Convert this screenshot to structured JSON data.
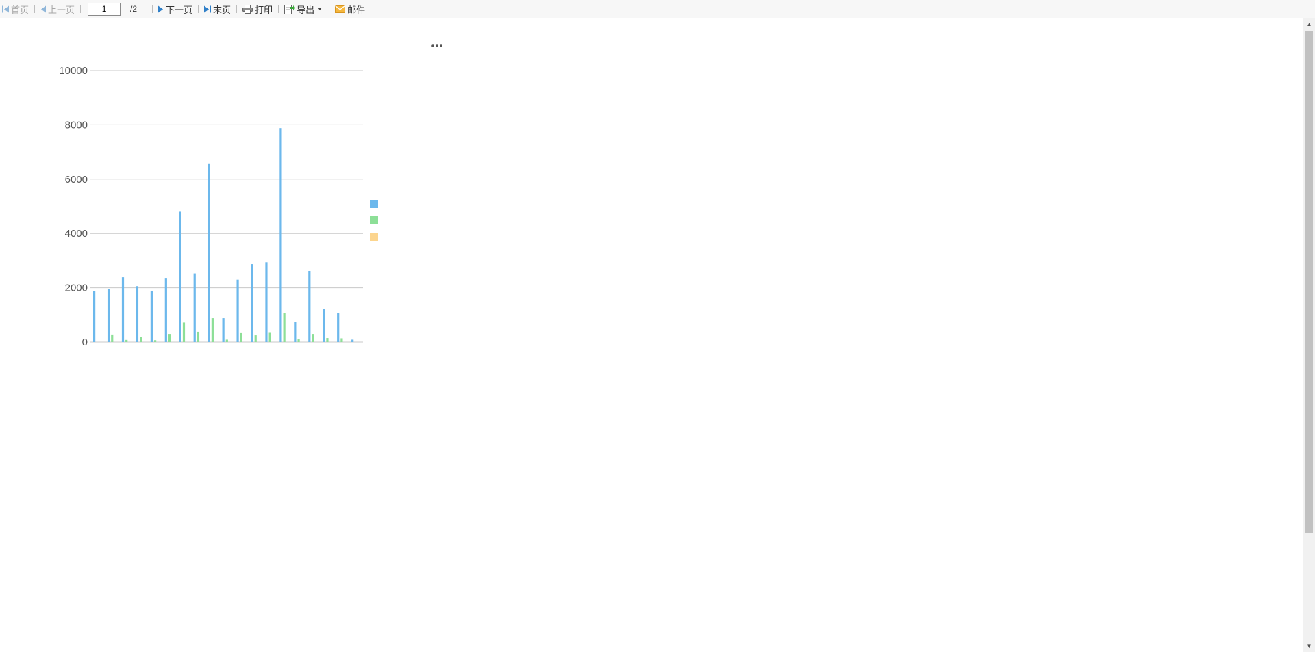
{
  "toolbar": {
    "first": "首页",
    "prev": "上一页",
    "page_value": "1",
    "page_total": "/2",
    "next": "下一页",
    "last": "末页",
    "print": "打印",
    "export": "导出",
    "mail": "邮件"
  },
  "chart_data": {
    "type": "bar",
    "title": "",
    "ylim": [
      0,
      10000
    ],
    "yticks": [
      0,
      2000,
      4000,
      6000,
      8000,
      10000
    ],
    "grid": true,
    "legend_position": "right",
    "categories": [
      "",
      "",
      "",
      "",
      "",
      "",
      "",
      "",
      "",
      "",
      "",
      "",
      "",
      "",
      "",
      "",
      "",
      "",
      ""
    ],
    "x_tick_labels": [
      "",
      "",
      "",
      ""
    ],
    "series": [
      {
        "name": "",
        "color": "#6cb8ec",
        "values": [
          1880,
          1960,
          2390,
          2060,
          1890,
          2340,
          4800,
          2530,
          6580,
          880,
          2300,
          2870,
          2940,
          7880,
          740,
          2620,
          1220,
          1070,
          90
        ]
      },
      {
        "name": "",
        "color": "#8ddf97",
        "values": [
          0,
          280,
          80,
          190,
          70,
          300,
          720,
          380,
          880,
          90,
          330,
          250,
          340,
          1060,
          100,
          300,
          150,
          140,
          0
        ]
      },
      {
        "name": "",
        "color": "#fcd58e",
        "values": [
          0,
          0,
          0,
          0,
          0,
          0,
          0,
          0,
          0,
          0,
          0,
          0,
          0,
          0,
          0,
          0,
          0,
          0,
          0
        ]
      }
    ]
  }
}
